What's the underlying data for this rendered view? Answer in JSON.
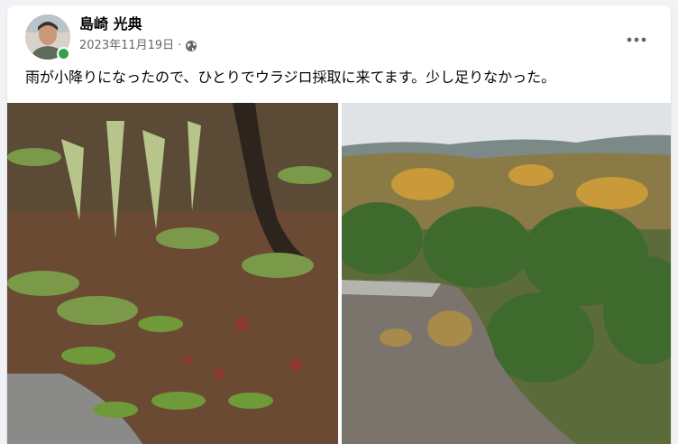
{
  "post": {
    "author_name": "島崎 光典",
    "date": "2023年11月19日",
    "separator": "·",
    "privacy_icon": "globe-icon",
    "more_icon": "more-options-icon",
    "text": "雨が小降りになったので、ひとりでウラジロ採取に来てます。少し足りなかった。",
    "online_status_color": "#31a24c"
  },
  "photos": [
    {
      "subject": "forest-floor-ferns-photo"
    },
    {
      "subject": "mountain-forest-view-photo"
    }
  ]
}
